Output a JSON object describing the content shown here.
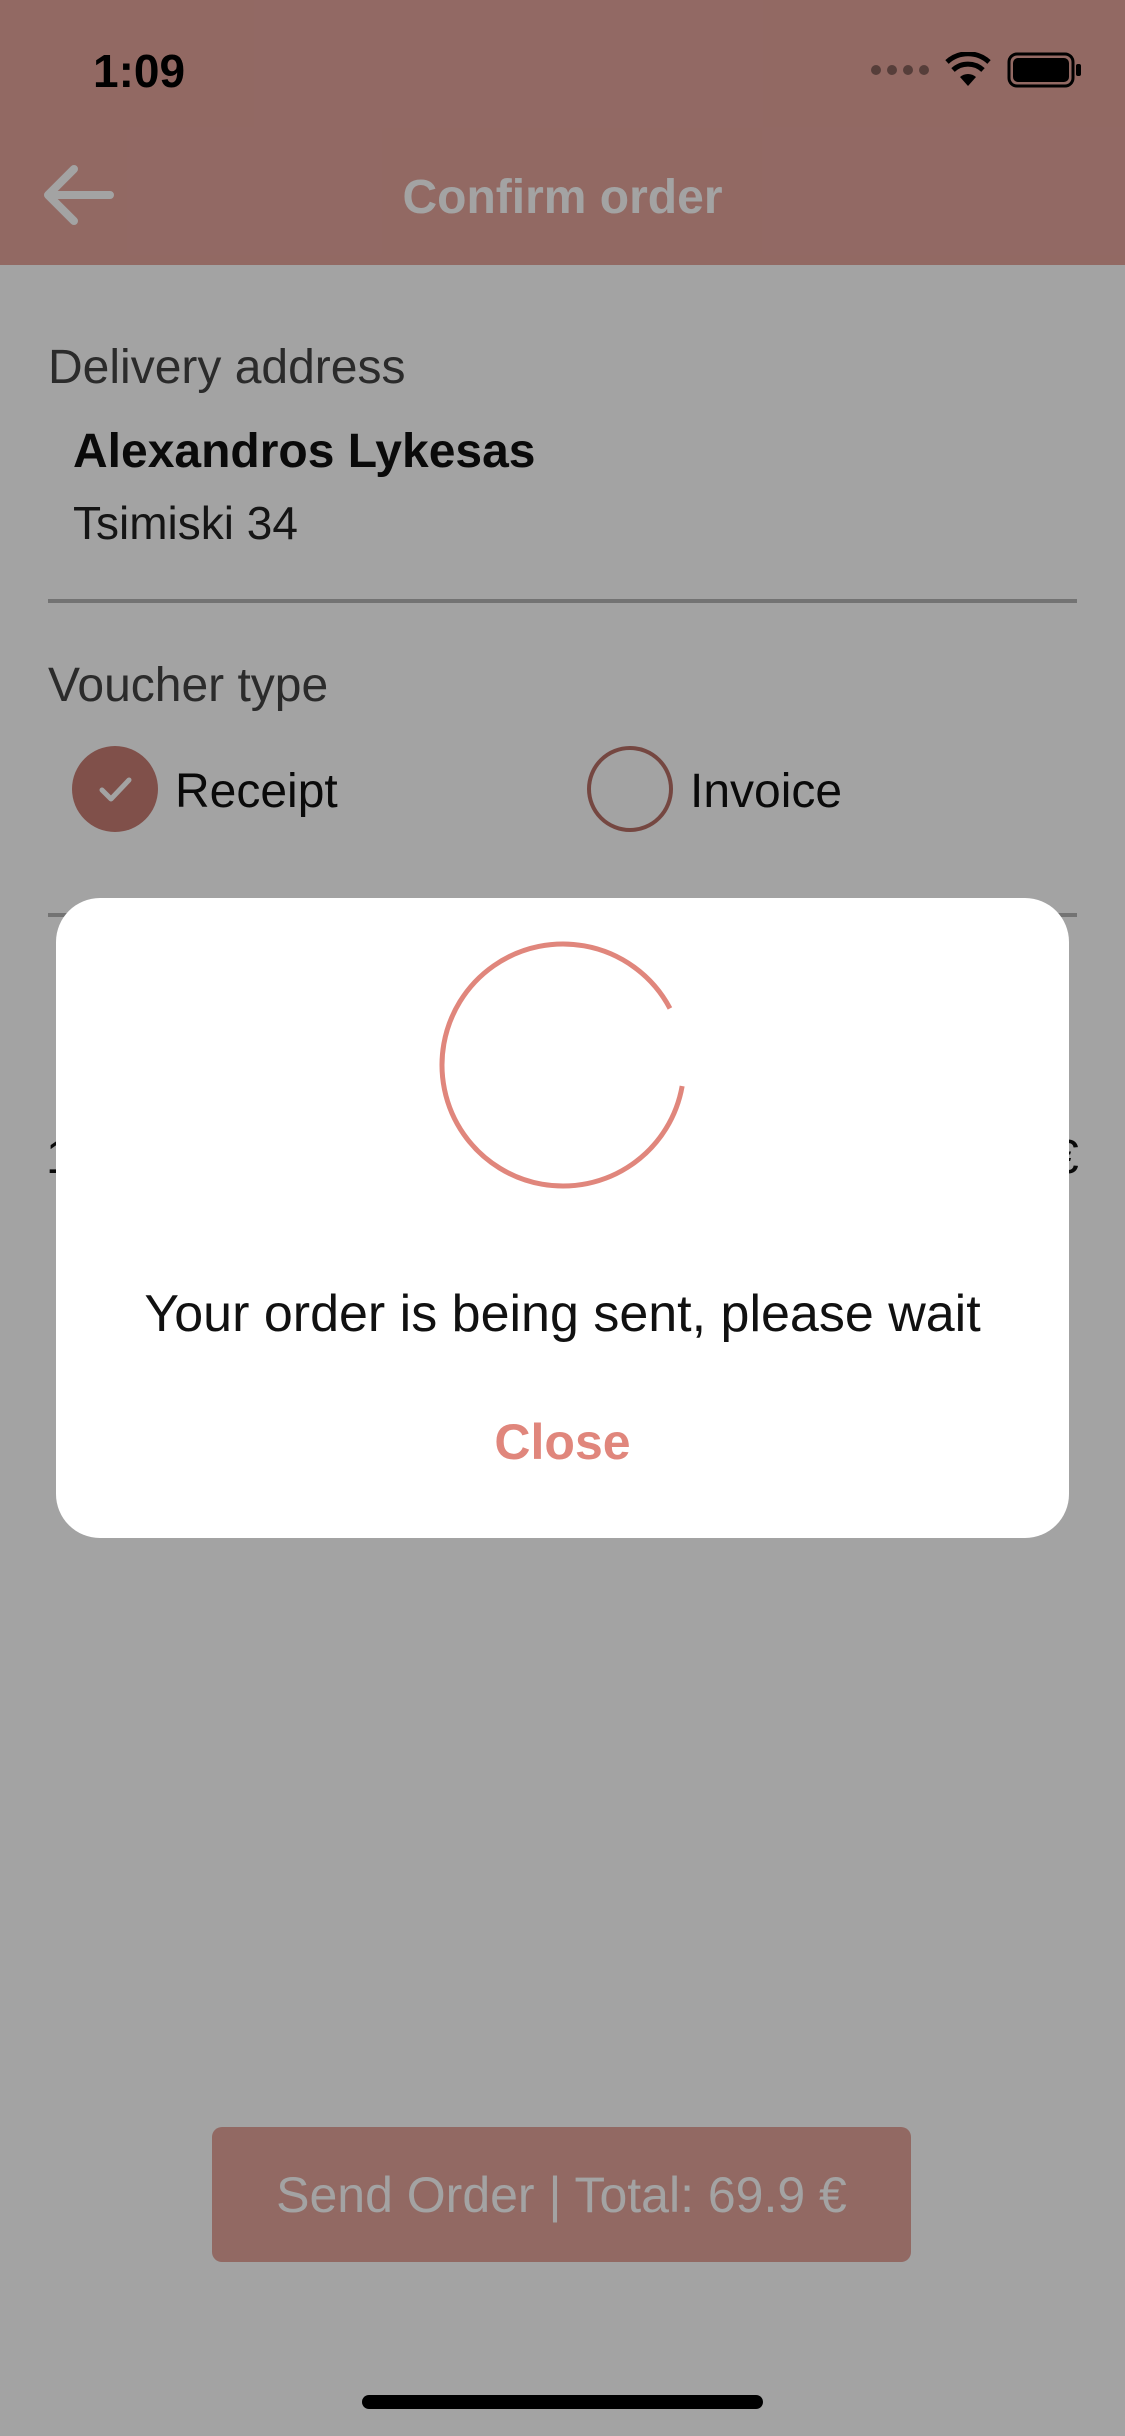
{
  "status_bar": {
    "time": "1:09"
  },
  "nav": {
    "title": "Confirm order",
    "back_icon": "arrow-left-icon"
  },
  "delivery": {
    "label": "Delivery address",
    "name": "Alexandros Lykesas",
    "street": "Tsimiski 34"
  },
  "voucher": {
    "label": "Voucher type",
    "options": [
      {
        "label": "Receipt",
        "selected": true
      },
      {
        "label": "Invoice",
        "selected": false
      }
    ]
  },
  "dialog": {
    "message": "Your order is being sent, please wait",
    "close_label": "Close"
  },
  "send_button": {
    "label": "Send Order | Total: 69.9 €"
  },
  "colors": {
    "brand": "#e5a59c",
    "accent": "#e0867c",
    "radio": "#c97d74"
  }
}
